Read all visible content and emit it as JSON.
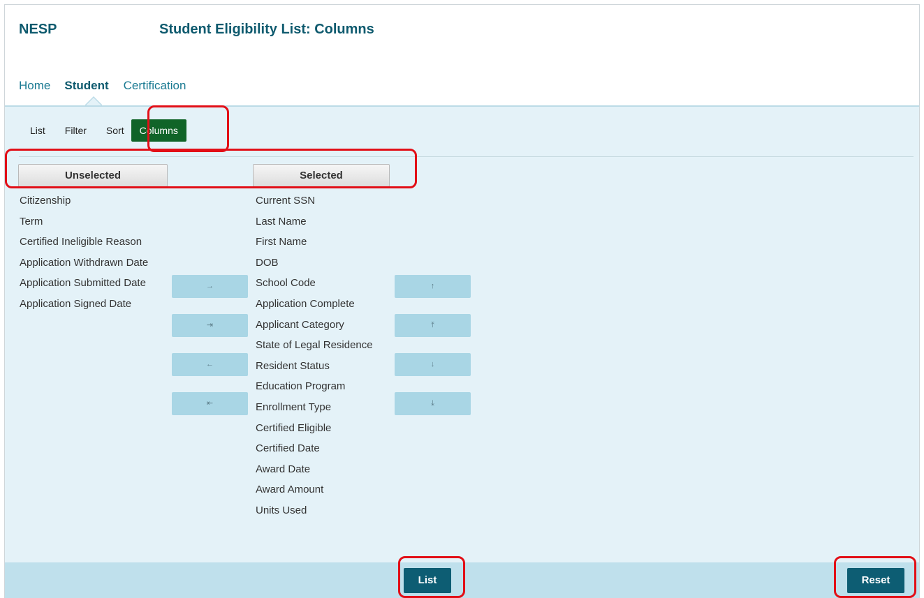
{
  "header": {
    "brand": "NESP",
    "title": "Student Eligibility List: Columns"
  },
  "main_nav": [
    {
      "label": "Home"
    },
    {
      "label": "Student",
      "active": true
    },
    {
      "label": "Certification"
    }
  ],
  "sub_nav": [
    {
      "label": "List"
    },
    {
      "label": "Filter"
    },
    {
      "label": "Sort"
    },
    {
      "label": "Columns",
      "active": true
    }
  ],
  "unselected": {
    "header": "Unselected",
    "items": [
      "Citizenship",
      "Term",
      "Certified Ineligible Reason",
      "Application Withdrawn Date",
      "Application Submitted Date",
      "Application Signed Date"
    ]
  },
  "selected": {
    "header": "Selected",
    "items": [
      "Current SSN",
      "Last Name",
      "First Name",
      "DOB",
      "School Code",
      "Application Complete",
      "Applicant Category",
      "State of Legal Residence",
      "Resident Status",
      "Education Program",
      "Enrollment Type",
      "Certified Eligible",
      "Certified Date",
      "Award Date",
      "Award Amount",
      "Units Used"
    ]
  },
  "transfer_buttons": [
    {
      "icon": "arrow-right-icon",
      "glyph": "→"
    },
    {
      "icon": "arrow-right-bar-icon",
      "glyph": "⇥"
    },
    {
      "icon": "arrow-left-icon",
      "glyph": "←"
    },
    {
      "icon": "arrow-left-bar-icon",
      "glyph": "⇤"
    }
  ],
  "order_buttons": [
    {
      "icon": "arrow-up-icon",
      "glyph": "↑"
    },
    {
      "icon": "arrow-top-icon",
      "glyph": "⤒"
    },
    {
      "icon": "arrow-down-icon",
      "glyph": "↓"
    },
    {
      "icon": "arrow-bottom-icon",
      "glyph": "⤓"
    }
  ],
  "footer": {
    "list_label": "List",
    "reset_label": "Reset"
  },
  "colors": {
    "brand": "#0e5a6e",
    "active_tab": "#106428",
    "content_bg": "#e4f2f8",
    "move_button": "#a9d6e5",
    "action_button": "#0d5d73",
    "highlight": "#e20f17"
  }
}
